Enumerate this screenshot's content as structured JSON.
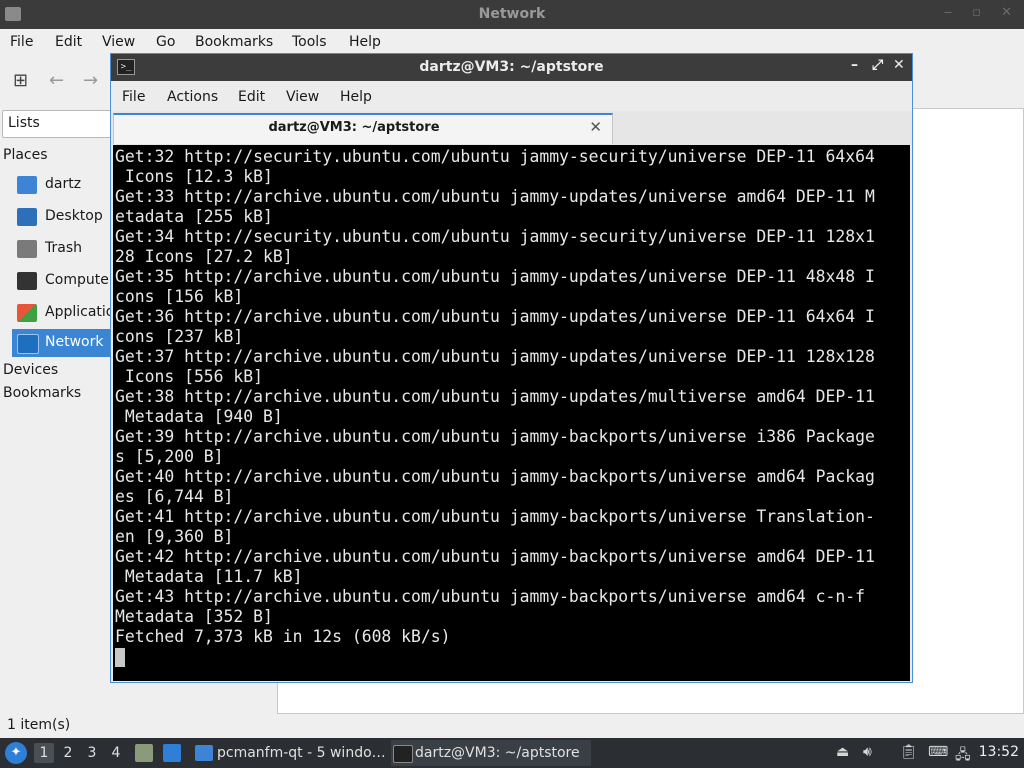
{
  "file_manager": {
    "title": "Network",
    "menu": [
      "File",
      "Edit",
      "View",
      "Go",
      "Bookmarks",
      "Tools",
      "Help"
    ],
    "sidebar": {
      "lists_label": "Lists",
      "places_header": "Places",
      "items": [
        {
          "label": "dartz",
          "icon": "home-folder-icon",
          "color": "#3d83d6"
        },
        {
          "label": "Desktop",
          "icon": "desktop-icon",
          "color": "#2d6fb8"
        },
        {
          "label": "Trash",
          "icon": "trash-icon",
          "color": "#7a7a7a"
        },
        {
          "label": "Computer",
          "icon": "computer-icon",
          "color": "#333333"
        },
        {
          "label": "Applications",
          "icon": "applications-icon",
          "color": "#e8563a"
        },
        {
          "label": "Network",
          "icon": "network-icon",
          "color": "#1f6fc0",
          "active": true
        }
      ],
      "devices_header": "Devices",
      "bookmarks_header": "Bookmarks"
    },
    "status": "1 item(s)"
  },
  "terminal": {
    "title": "dartz@VM3: ~/aptstore",
    "menu": [
      "File",
      "Actions",
      "Edit",
      "View",
      "Help"
    ],
    "tab_label": "dartz@VM3: ~/aptstore",
    "lines": [
      "Get:32 http://security.ubuntu.com/ubuntu jammy-security/universe DEP-11 64x64",
      " Icons [12.3 kB]",
      "Get:33 http://archive.ubuntu.com/ubuntu jammy-updates/universe amd64 DEP-11 M",
      "etadata [255 kB]",
      "Get:34 http://security.ubuntu.com/ubuntu jammy-security/universe DEP-11 128x1",
      "28 Icons [27.2 kB]",
      "Get:35 http://archive.ubuntu.com/ubuntu jammy-updates/universe DEP-11 48x48 I",
      "cons [156 kB]",
      "Get:36 http://archive.ubuntu.com/ubuntu jammy-updates/universe DEP-11 64x64 I",
      "cons [237 kB]",
      "Get:37 http://archive.ubuntu.com/ubuntu jammy-updates/universe DEP-11 128x128",
      " Icons [556 kB]",
      "Get:38 http://archive.ubuntu.com/ubuntu jammy-updates/multiverse amd64 DEP-11",
      " Metadata [940 B]",
      "Get:39 http://archive.ubuntu.com/ubuntu jammy-backports/universe i386 Package",
      "s [5,200 B]",
      "Get:40 http://archive.ubuntu.com/ubuntu jammy-backports/universe amd64 Packag",
      "es [6,744 B]",
      "Get:41 http://archive.ubuntu.com/ubuntu jammy-backports/universe Translation-",
      "en [9,360 B]",
      "Get:42 http://archive.ubuntu.com/ubuntu jammy-backports/universe amd64 DEP-11",
      " Metadata [11.7 kB]",
      "Get:43 http://archive.ubuntu.com/ubuntu jammy-backports/universe amd64 c-n-f",
      "Metadata [352 B]",
      "Fetched 7,373 kB in 12s (608 kB/s)"
    ]
  },
  "taskbar": {
    "workspaces": [
      "1",
      "2",
      "3",
      "4"
    ],
    "active_workspace": "1",
    "tasks": [
      {
        "label": "pcmanfm-qt - 5 windo…",
        "icon": "folder-icon"
      },
      {
        "label": "dartz@VM3: ~/aptstore",
        "icon": "terminal-icon"
      }
    ],
    "clock": "13:52"
  },
  "colors": {
    "accent": "#3b86d4",
    "titlebar": "#3c3c3c",
    "terminal_bg": "#000000",
    "terminal_fg": "#e8e8e8",
    "taskbar_bg": "#2b2f33"
  }
}
